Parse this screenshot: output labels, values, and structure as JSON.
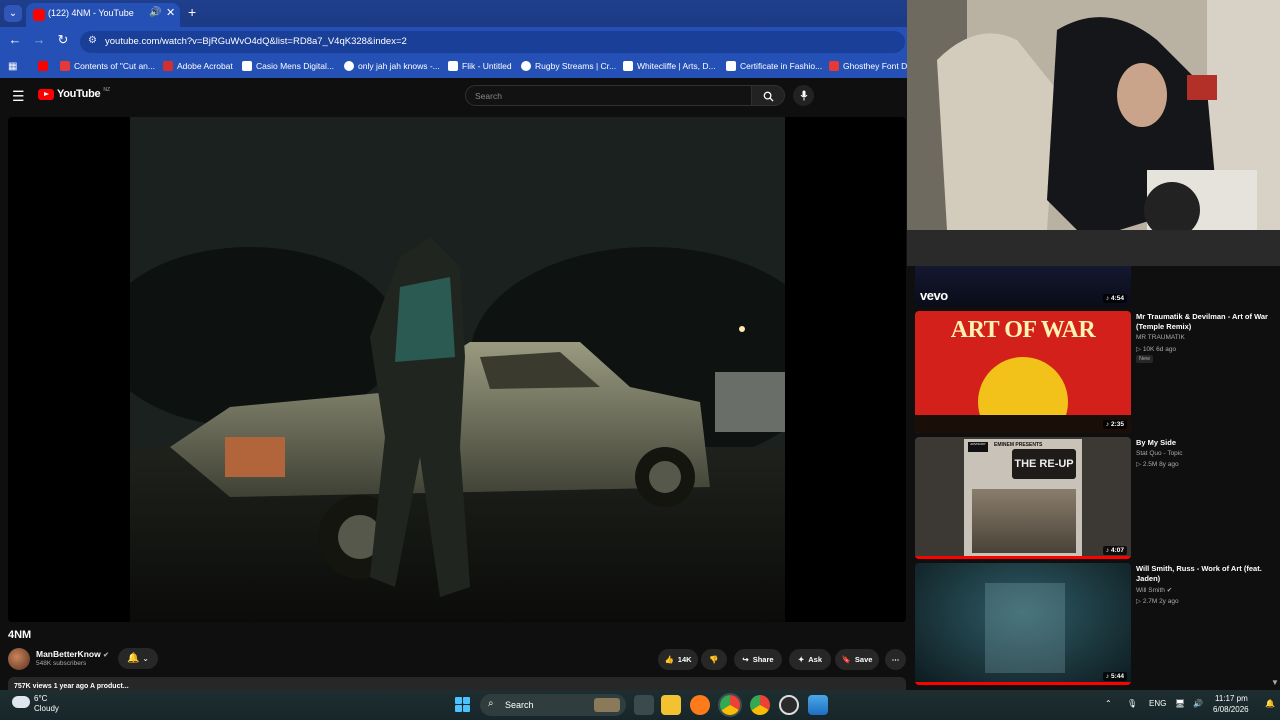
{
  "browser": {
    "tab": {
      "title": "(122) 4NM - YouTube"
    },
    "url": "youtube.com/watch?v=BjRGuWvO4dQ&list=RD8a7_V4qK328&index=2",
    "bookmarks": [
      {
        "label": "",
        "color": "#ff0000"
      },
      {
        "label": "Contents of \"Cut an...",
        "color": "#e53935"
      },
      {
        "label": "Adobe Acrobat",
        "color": "#d32f2f"
      },
      {
        "label": "Casio Mens Digital...",
        "color": "#ffffff"
      },
      {
        "label": "only jah jah knows -...",
        "color": "#ffffff"
      },
      {
        "label": "Flik - Untitled",
        "color": "#ffffff"
      },
      {
        "label": "Rugby Streams | Cr...",
        "color": "#ffffff"
      },
      {
        "label": "Whitecliffe | Arts, D...",
        "color": "#ffffff"
      },
      {
        "label": "Certificate in Fashio...",
        "color": "#ffffff"
      },
      {
        "label": "Ghosthey Font Do",
        "color": "#e53935"
      }
    ]
  },
  "youtube": {
    "logo_text": "YouTube",
    "logo_country": "NZ",
    "search_placeholder": "Search"
  },
  "video": {
    "title": "4NM",
    "channel": "ManBetterKnow",
    "subscribers": "548K subscribers",
    "likes": "14K",
    "share_label": "Share",
    "ask_label": "Ask",
    "save_label": "Save",
    "description_partial": "757K views  1 year ago  A product..."
  },
  "recommendations": [
    {
      "title": "",
      "channel": "",
      "meta": "",
      "duration": "4:54",
      "badge_text": "vevo"
    },
    {
      "title": "Mr Traumatik & Devilman - Art of War (Temple Remix)",
      "channel": "MR TRAUMATIK",
      "meta": "10K  6d ago",
      "badge": "New",
      "duration": "2:35",
      "thumb_text": "ART OF WAR"
    },
    {
      "title": "By My Side",
      "channel": "Stat Quo - Topic",
      "meta": "2.5M  8y ago",
      "duration": "4:07",
      "thumb_text": "THE RE-UP",
      "thumb_subtext": "EMINEM PRESENTS"
    },
    {
      "title": "Will Smith, Russ - Work of Art (feat. Jaden)",
      "channel": "Will Smith",
      "meta": "2.7M  2y ago",
      "duration": "5:44"
    }
  ],
  "taskbar": {
    "weather_temp": "6°C",
    "weather_desc": "Cloudy",
    "search_label": "Search",
    "lang": "ENG",
    "time": "11:17 pm",
    "date": "6/08/2026"
  }
}
